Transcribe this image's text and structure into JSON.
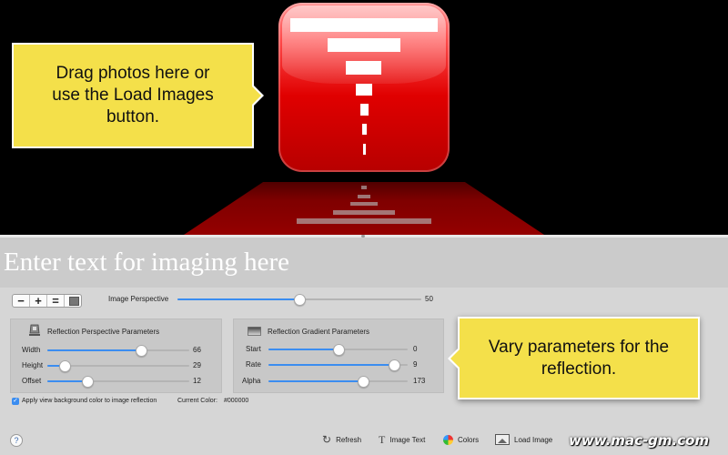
{
  "preview": {
    "drop_hint_lines": [
      "Drag photos here or",
      "use the Load Images",
      "button."
    ]
  },
  "text_input": {
    "placeholder": "Enter text for imaging here"
  },
  "toolbar_controls": {
    "minus": "−",
    "plus": "+",
    "equal": "="
  },
  "perspective": {
    "label": "Image Perspective",
    "value": "50",
    "fraction": 0.5
  },
  "reflection_perspective": {
    "title": "Reflection Perspective Parameters",
    "params": [
      {
        "label": "Width",
        "value": "66",
        "fraction": 0.66
      },
      {
        "label": "Height",
        "value": "29",
        "fraction": 0.12
      },
      {
        "label": "Offset",
        "value": "12",
        "fraction": 0.28
      }
    ]
  },
  "reflection_gradient": {
    "title": "Reflection Gradient Parameters",
    "params": [
      {
        "label": "Start",
        "value": "0",
        "fraction": 0.5
      },
      {
        "label": "Rate",
        "value": "9",
        "fraction": 0.9
      },
      {
        "label": "Alpha",
        "value": "173",
        "fraction": 0.68
      }
    ]
  },
  "vary_hint_lines": [
    "Vary parameters for the",
    "reflection."
  ],
  "apply_bg": {
    "label": "Apply view background color to image reflection",
    "checked": true,
    "current_color_label": "Current Color:",
    "current_color_value": "#000000"
  },
  "bottom_toolbar": {
    "help": "?",
    "refresh": "Refresh",
    "image_text": "Image Text",
    "colors": "Colors",
    "load_image": "Load Image"
  },
  "watermark": "www.mac-gm.com",
  "colors": {
    "accent": "#3b8df0",
    "tip_yellow": "#f4e04a",
    "icon_red": "#e00000"
  }
}
